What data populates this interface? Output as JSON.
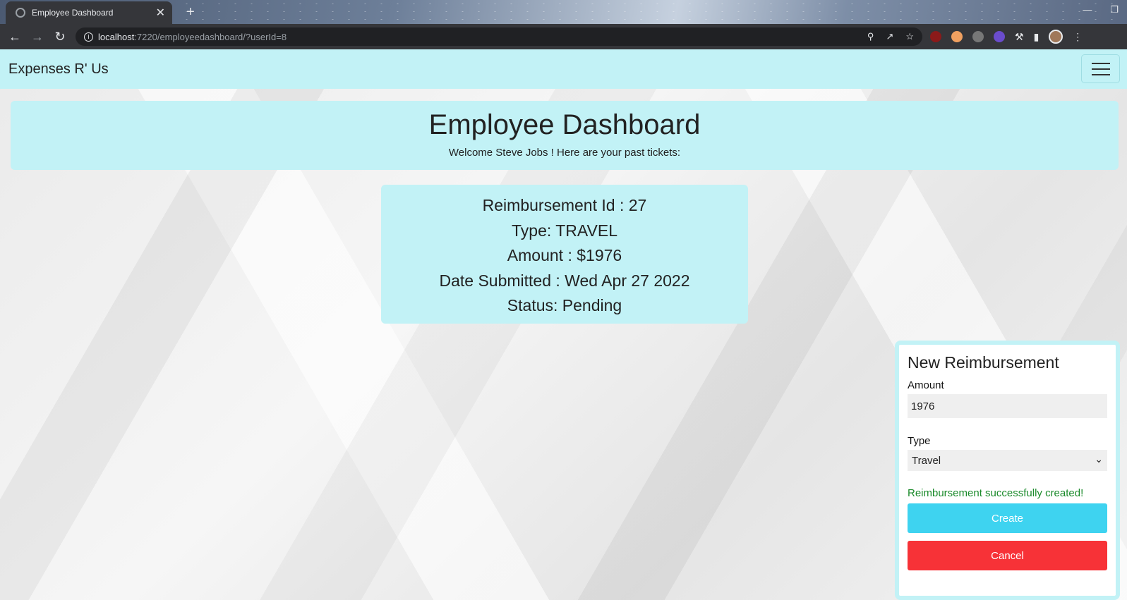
{
  "browser": {
    "tab_title": "Employee Dashboard",
    "tab_close": "✕",
    "new_tab": "+",
    "url_host": "localhost",
    "url_path": ":7220/employeedashboard/?userId=8",
    "icons": [
      "back-arrow-icon",
      "forward-arrow-icon",
      "reload-icon",
      "info-icon",
      "key-icon",
      "share-icon",
      "star-icon",
      "extensions-icon",
      "side-panel-icon",
      "avatar",
      "menu-icon"
    ]
  },
  "navbar": {
    "brand": "Expenses R' Us"
  },
  "header": {
    "title": "Employee Dashboard",
    "subtitle": "Welcome Steve Jobs ! Here are your past tickets:"
  },
  "ticket": {
    "id_line": "Reimbursement Id : 27",
    "type_line": "Type: TRAVEL",
    "amount_line": "Amount : $1976",
    "date_line": "Date Submitted : Wed Apr 27 2022",
    "status_line": "Status: Pending"
  },
  "form": {
    "title": "New Reimbursement",
    "amount_label": "Amount",
    "amount_value": "1976",
    "type_label": "Type",
    "type_selected": "Travel",
    "success_message": "Reimbursement successfully created!",
    "create_label": "Create",
    "cancel_label": "Cancel"
  },
  "colors": {
    "panel": "#c2f2f6",
    "create": "#3ed3f0",
    "cancel": "#f73237",
    "success": "#1a8a2a"
  }
}
